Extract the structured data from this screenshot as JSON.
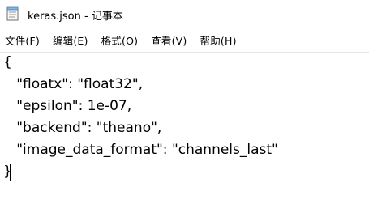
{
  "window": {
    "title": "keras.json - 记事本",
    "icon": "notepad-icon"
  },
  "menu": {
    "items": [
      {
        "label": "文件(F)"
      },
      {
        "label": "编辑(E)"
      },
      {
        "label": "格式(O)"
      },
      {
        "label": "查看(V)"
      },
      {
        "label": "帮助(H)"
      }
    ]
  },
  "editor": {
    "lines": [
      "{",
      "   \"floatx\": \"float32\",",
      "   \"epsilon\": 1e-07,",
      "   \"backend\": \"theano\",",
      "   \"image_data_format\": \"channels_last\"",
      "}"
    ]
  }
}
